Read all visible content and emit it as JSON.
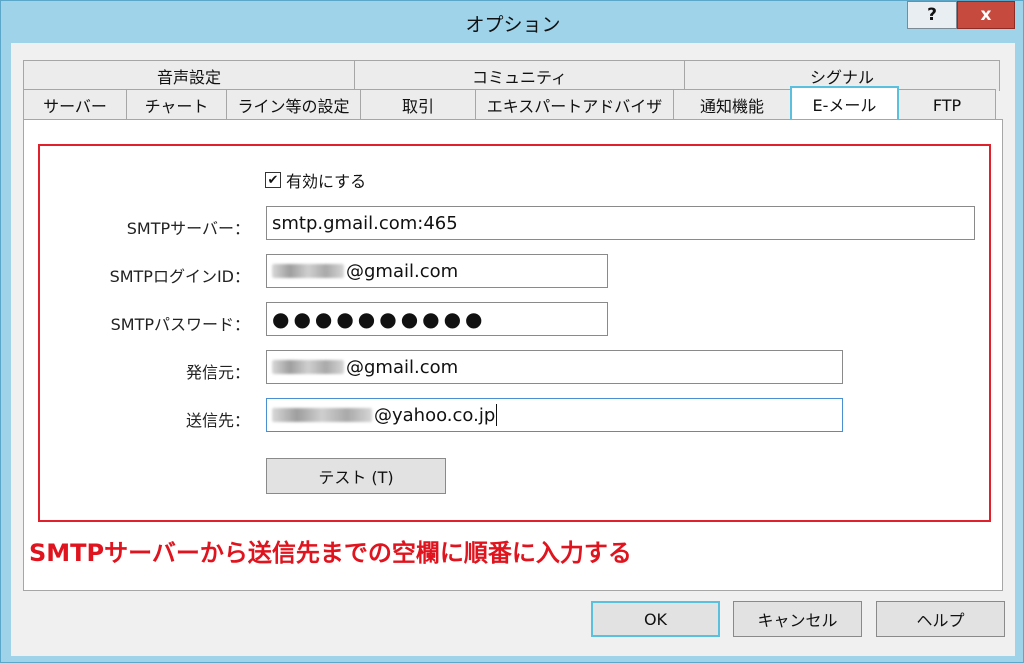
{
  "window": {
    "title": "オプション",
    "help_label": "?",
    "close_label": "x"
  },
  "tabs": {
    "top_row": [
      "音声設定",
      "コミュニティ",
      "シグナル"
    ],
    "bottom_row": [
      "サーバー",
      "チャート",
      "ライン等の設定",
      "取引",
      "エキスパートアドバイザ",
      "通知機能",
      "E-メール",
      "FTP"
    ],
    "active": "E-メール"
  },
  "form": {
    "enable_label": "有効にする",
    "enable_checked": true,
    "smtp_server_label": "SMTPサーバー：",
    "smtp_server_value": "smtp.gmail.com:465",
    "login_id_label": "SMTPログインID：",
    "login_id_value": "@gmail.com",
    "password_label": "SMTPパスワード：",
    "password_value": "●●●●●●●●●●",
    "from_label": "発信元：",
    "from_value": "@gmail.com",
    "to_label": "送信先：",
    "to_value": "@yahoo.co.jp",
    "test_button": "テスト (T)"
  },
  "annotation": {
    "text": "SMTPサーバーから送信先までの空欄に順番に入力する",
    "color": "#e0141e"
  },
  "footer": {
    "ok": "OK",
    "cancel": "キャンセル",
    "help": "ヘルプ"
  },
  "colors": {
    "window_frame": "#9fd3ea",
    "focus_accent": "#5bc0de",
    "highlight_border": "#e0202a"
  }
}
